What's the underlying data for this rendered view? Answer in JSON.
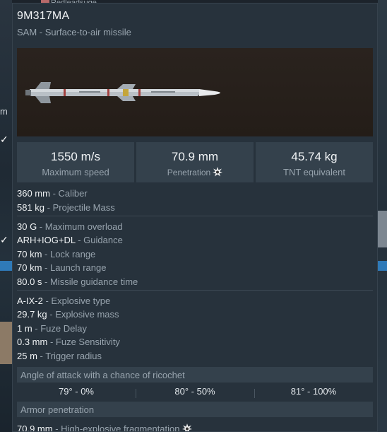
{
  "background": {
    "top_text": "Redleadsuge",
    "left_letter": "m"
  },
  "tooltip": {
    "title": "9M317MA",
    "subtitle": "SAM - Surface-to-air missile",
    "stats": [
      {
        "value": "1550 m/s",
        "label": "Maximum speed"
      },
      {
        "value": "70.9 mm",
        "label": "Penetration"
      },
      {
        "value": "45.74 kg",
        "label": "TNT equivalent"
      }
    ],
    "group1": [
      {
        "value": "360 mm",
        "desc": " - Caliber"
      },
      {
        "value": "581 kg",
        "desc": " - Projectile Mass"
      }
    ],
    "group2": [
      {
        "value": "30 G",
        "desc": " - Maximum overload"
      },
      {
        "value": "ARH+IOG+DL",
        "desc": " - Guidance"
      },
      {
        "value": "70 km",
        "desc": " - Lock range"
      },
      {
        "value": "70 km",
        "desc": " - Launch range"
      },
      {
        "value": "80.0 s",
        "desc": " - Missile guidance time"
      }
    ],
    "group3": [
      {
        "value": "A-IX-2",
        "desc": " - Explosive type"
      },
      {
        "value": "29.7 kg",
        "desc": " - Explosive mass"
      },
      {
        "value": "1 m",
        "desc": " - Fuze Delay"
      },
      {
        "value": "0.3 mm",
        "desc": " - Fuze Sensitivity"
      },
      {
        "value": "25 m",
        "desc": " - Trigger radius"
      }
    ],
    "ricochet_header": "Angle of attack with a chance of ricochet",
    "ricochet": [
      "79° - 0%",
      "80° - 50%",
      "81° - 100%"
    ],
    "armor_header": "Armor penetration",
    "armor_rows": [
      {
        "value": "70.9 mm",
        "desc": " - High-explosive fragmentation"
      }
    ],
    "icons": {
      "penetration": "explosion-icon"
    }
  }
}
